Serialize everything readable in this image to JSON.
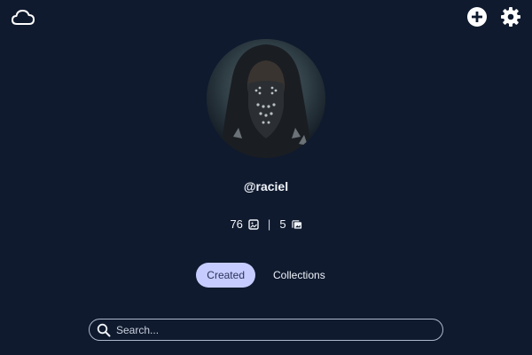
{
  "header": {
    "left_icon": "cloud-icon",
    "right_icons": [
      "add-circle-icon",
      "gear-icon"
    ]
  },
  "profile": {
    "username": "@raciel",
    "images_count": "76",
    "images_icon": "image-icon",
    "separator": "|",
    "collections_count": "5",
    "collections_icon": "photo-album-icon"
  },
  "tabs": [
    {
      "label": "Created",
      "active": true
    },
    {
      "label": "Collections",
      "active": false
    }
  ],
  "search": {
    "placeholder": "Search...",
    "value": ""
  },
  "colors": {
    "background": "#0f1a2e",
    "active_tab": "#c6ccff"
  }
}
